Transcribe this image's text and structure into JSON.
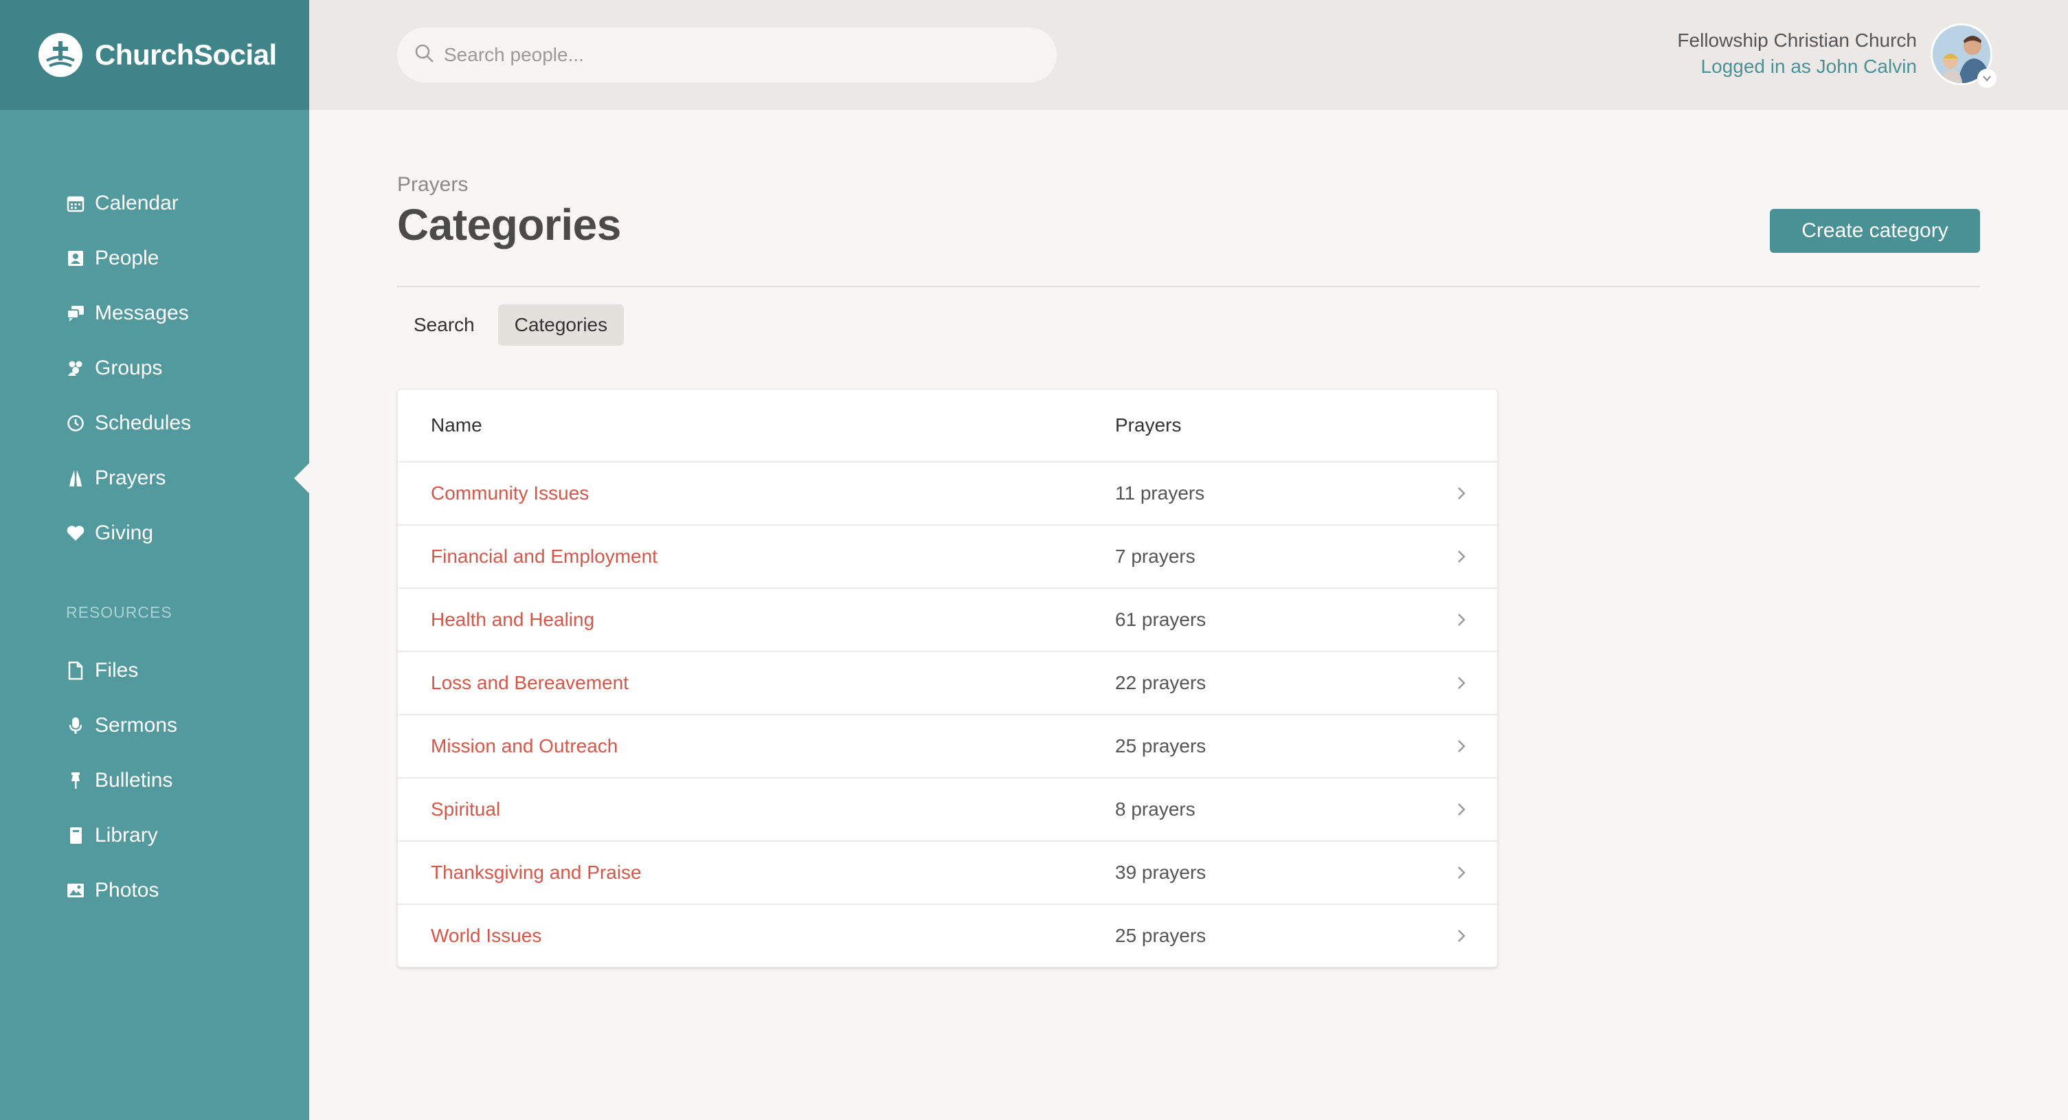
{
  "brand": {
    "name": "ChurchSocial"
  },
  "search": {
    "placeholder": "Search people..."
  },
  "user": {
    "church": "Fellowship Christian Church",
    "logged_in": "Logged in as John Calvin"
  },
  "sidebar": {
    "items": [
      {
        "label": "Calendar",
        "icon": "calendar-icon"
      },
      {
        "label": "People",
        "icon": "people-icon"
      },
      {
        "label": "Messages",
        "icon": "messages-icon"
      },
      {
        "label": "Groups",
        "icon": "groups-icon"
      },
      {
        "label": "Schedules",
        "icon": "clock-icon"
      },
      {
        "label": "Prayers",
        "icon": "praying-hands-icon",
        "active": true
      },
      {
        "label": "Giving",
        "icon": "heart-icon"
      }
    ],
    "resources_label": "RESOURCES",
    "resources": [
      {
        "label": "Files",
        "icon": "file-icon"
      },
      {
        "label": "Sermons",
        "icon": "microphone-icon"
      },
      {
        "label": "Bulletins",
        "icon": "pin-icon"
      },
      {
        "label": "Library",
        "icon": "book-icon"
      },
      {
        "label": "Photos",
        "icon": "image-icon"
      }
    ]
  },
  "page": {
    "breadcrumb": "Prayers",
    "title": "Categories",
    "create_label": "Create category",
    "tabs": [
      {
        "label": "Search"
      },
      {
        "label": "Categories",
        "active": true
      }
    ]
  },
  "table": {
    "headers": {
      "name": "Name",
      "prayers": "Prayers"
    },
    "rows": [
      {
        "name": "Community Issues",
        "count": "11 prayers"
      },
      {
        "name": "Financial and Employment",
        "count": "7 prayers"
      },
      {
        "name": "Health and Healing",
        "count": "61 prayers"
      },
      {
        "name": "Loss and Bereavement",
        "count": "22 prayers"
      },
      {
        "name": "Mission and Outreach",
        "count": "25 prayers"
      },
      {
        "name": "Spiritual",
        "count": "8 prayers"
      },
      {
        "name": "Thanksgiving and Praise",
        "count": "39 prayers"
      },
      {
        "name": "World Issues",
        "count": "25 prayers"
      }
    ]
  },
  "colors": {
    "sidebar": "#539a9e",
    "brand_bar": "#3e8488",
    "accent": "#4a9196",
    "link": "#d6574a"
  }
}
